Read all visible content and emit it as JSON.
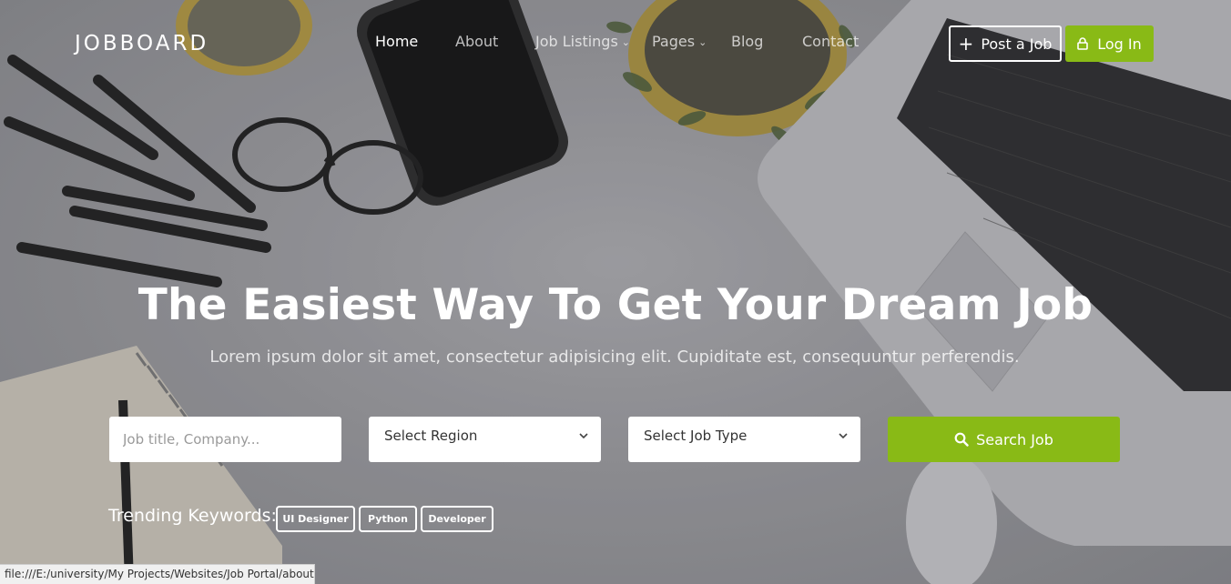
{
  "brand": {
    "logo": "JOBBOARD"
  },
  "nav": {
    "items": [
      {
        "label": "Home",
        "active": true
      },
      {
        "label": "About"
      },
      {
        "label": "Job Listings"
      },
      {
        "label": "Pages"
      },
      {
        "label": "Blog"
      },
      {
        "label": "Contact"
      }
    ]
  },
  "header_buttons": {
    "post_job": "Post a Job",
    "login": "Log In"
  },
  "hero": {
    "title": "The Easiest Way To Get Your Dream Job",
    "subtitle": "Lorem ipsum dolor sit amet, consectetur adipisicing elit. Cupiditate est, consequuntur perferendis."
  },
  "search": {
    "keyword_placeholder": "Job title, Company...",
    "region_selected": "Select Region",
    "jobtype_selected": "Select Job Type",
    "button_label": "Search Job"
  },
  "trending": {
    "label": "Trending Keywords:",
    "tags": [
      "UI Designer",
      "Python",
      "Developer"
    ]
  },
  "status_bar": {
    "url": "file:///E:/university/My Projects/Websites/Job Portal/about.html"
  },
  "colors": {
    "accent": "#89ba16",
    "text_light": "#ffffff"
  }
}
